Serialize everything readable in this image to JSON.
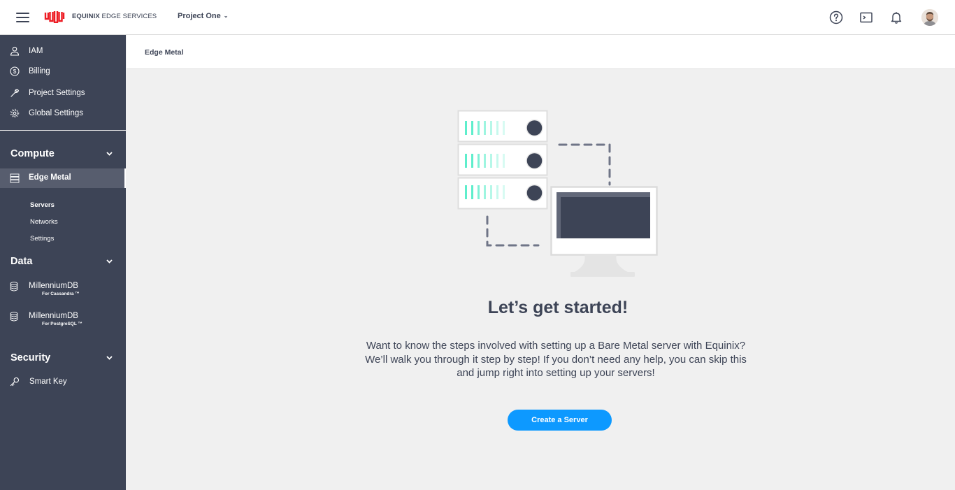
{
  "topbar": {
    "brand_bold": "EQUINIX",
    "brand_rest": "EDGE SERVICES",
    "project_name": "Project One",
    "icons": [
      "menu-icon",
      "equinix-logo",
      "help-icon",
      "terminal-icon",
      "bell-icon",
      "avatar"
    ]
  },
  "sidebar": {
    "top_items": [
      {
        "label": "IAM",
        "icon": "user-icon"
      },
      {
        "label": "Billing",
        "icon": "dollar-icon"
      },
      {
        "label": "Project Settings",
        "icon": "wrench-icon"
      },
      {
        "label": "Global Settings",
        "icon": "gear-icon"
      }
    ],
    "compute": {
      "title": "Compute",
      "active_item": "Edge Metal",
      "sub_items": [
        "Servers",
        "Networks",
        "Settings"
      ]
    },
    "data": {
      "title": "Data",
      "items": [
        {
          "label": "MillenniumDB",
          "sub": "For Cassandra ™"
        },
        {
          "label": "MillenniumDB",
          "sub": "For PostgreSQL ™"
        }
      ]
    },
    "security": {
      "title": "Security",
      "items": [
        {
          "label": "Smart Key",
          "icon": "key-icon"
        }
      ]
    }
  },
  "main": {
    "breadcrumb": "Edge Metal",
    "headline": "Let’s get started!",
    "description": "Want to know the steps involved with setting up a Bare Metal server with Equinix? We’ll walk you through it step by step! If you don’t need any help, you can skip this and jump right into setting up your servers!",
    "cta_label": "Create a Server"
  },
  "colors": {
    "sidebar_bg": "#3d4456",
    "sidebar_active": "#575d6e",
    "text_dark": "#3d4456",
    "accent_blue": "#0d99ff",
    "brand_red": "#ed1c24",
    "teal": "#5eeecc",
    "page_bg": "#f0f0f0"
  }
}
